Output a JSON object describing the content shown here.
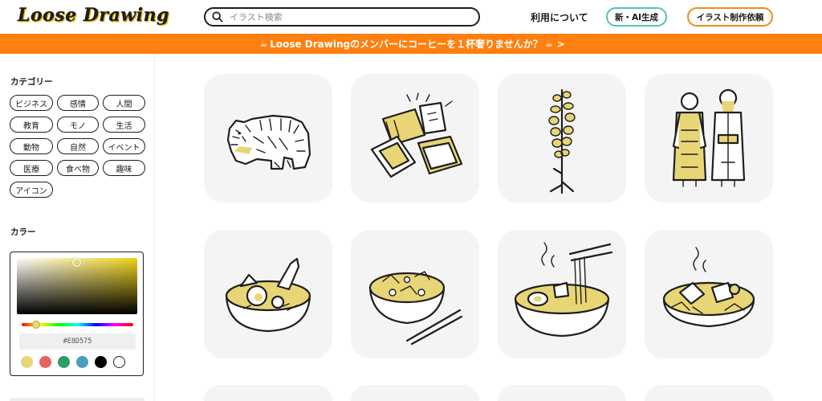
{
  "header": {
    "logo": "Loose Drawing",
    "search_placeholder": "イラスト検索",
    "about_link": "利用について",
    "ai_button": "新・AI生成",
    "request_button": "イラスト制作依頼"
  },
  "banner": {
    "text": "Loose Drawingのメンバーにコーヒーを１杯奢りませんか？",
    "icon": "coffee-cup-icon",
    "arrow": ">"
  },
  "sidebar": {
    "category_title": "カテゴリー",
    "categories": [
      "ビジネス",
      "感情",
      "人間",
      "教育",
      "モノ",
      "生活",
      "動物",
      "自然",
      "イベント",
      "医療",
      "食べ物",
      "趣味",
      "アイコン"
    ],
    "color_title": "カラー",
    "color_picker": {
      "hex_value": "#E8D575",
      "accent": "#E8D575",
      "swatches": [
        "#e8d575",
        "#e8615d",
        "#2e9c67",
        "#4b9fc0",
        "#000000",
        "#ffffff"
      ]
    }
  },
  "gallery": {
    "items": [
      {
        "subject": "tiger",
        "icon": "tiger-illustration"
      },
      {
        "subject": "food-packages",
        "icon": "packages-illustration"
      },
      {
        "subject": "flower-stem",
        "icon": "flower-illustration"
      },
      {
        "subject": "ainu-couple",
        "icon": "couple-illustration"
      },
      {
        "subject": "soup-curry",
        "icon": "soup-curry-illustration"
      },
      {
        "subject": "noodle-bowl-chopsticks",
        "icon": "bowl-chopsticks-illustration"
      },
      {
        "subject": "ramen",
        "icon": "ramen-illustration"
      },
      {
        "subject": "hot-pot-dish",
        "icon": "hot-dish-illustration"
      }
    ]
  }
}
